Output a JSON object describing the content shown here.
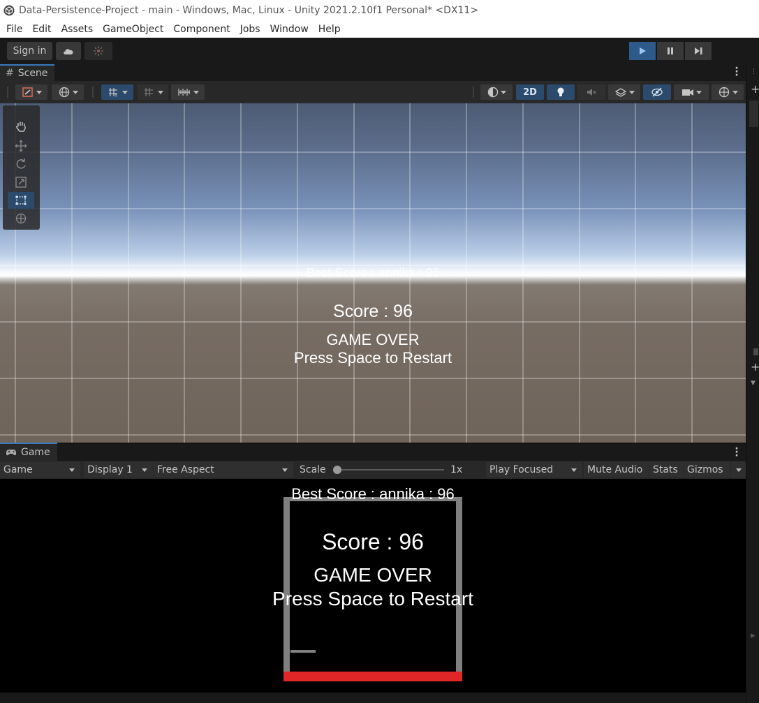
{
  "window": {
    "title": "Data-Persistence-Project - main - Windows, Mac, Linux - Unity 2021.2.10f1 Personal* <DX11>"
  },
  "menu": {
    "items": [
      "File",
      "Edit",
      "Assets",
      "GameObject",
      "Component",
      "Jobs",
      "Window",
      "Help"
    ]
  },
  "toolbar": {
    "sign_in_label": "Sign in",
    "cloud_icon": "cloud-icon",
    "collab_icon": "collab-icon",
    "play_icon": "play-icon",
    "pause_icon": "pause-icon",
    "step_icon": "step-icon",
    "play_active": true,
    "accent_color": "#2d5a8a"
  },
  "scene_panel": {
    "tab_label": "Scene",
    "toggle_2d_label": "2D",
    "overlay": {
      "best_score": "Best Score : annika : 96",
      "score": "Score : 96",
      "game_over": "GAME OVER",
      "restart_hint": "Press Space to Restart"
    },
    "tools": [
      "hand-tool",
      "move-tool",
      "rotate-tool",
      "scale-tool",
      "rect-tool",
      "transform-tool"
    ],
    "selected_tool": "rect-tool"
  },
  "game_panel": {
    "tab_label": "Game",
    "toolbar": {
      "view_select": "Game",
      "display_select": "Display 1",
      "aspect_select": "Free Aspect",
      "scale_label": "Scale",
      "scale_value": "1x",
      "play_mode_select": "Play Focused",
      "mute_audio": "Mute Audio",
      "stats": "Stats",
      "gizmos": "Gizmos"
    },
    "hud": {
      "best_score": "Best Score : annika : 96",
      "score": "Score : 96",
      "game_over": "GAME OVER",
      "restart_hint": "Press Space to Restart"
    },
    "paddle_color": "#e02626",
    "wall_color": "#7f7f7f"
  }
}
